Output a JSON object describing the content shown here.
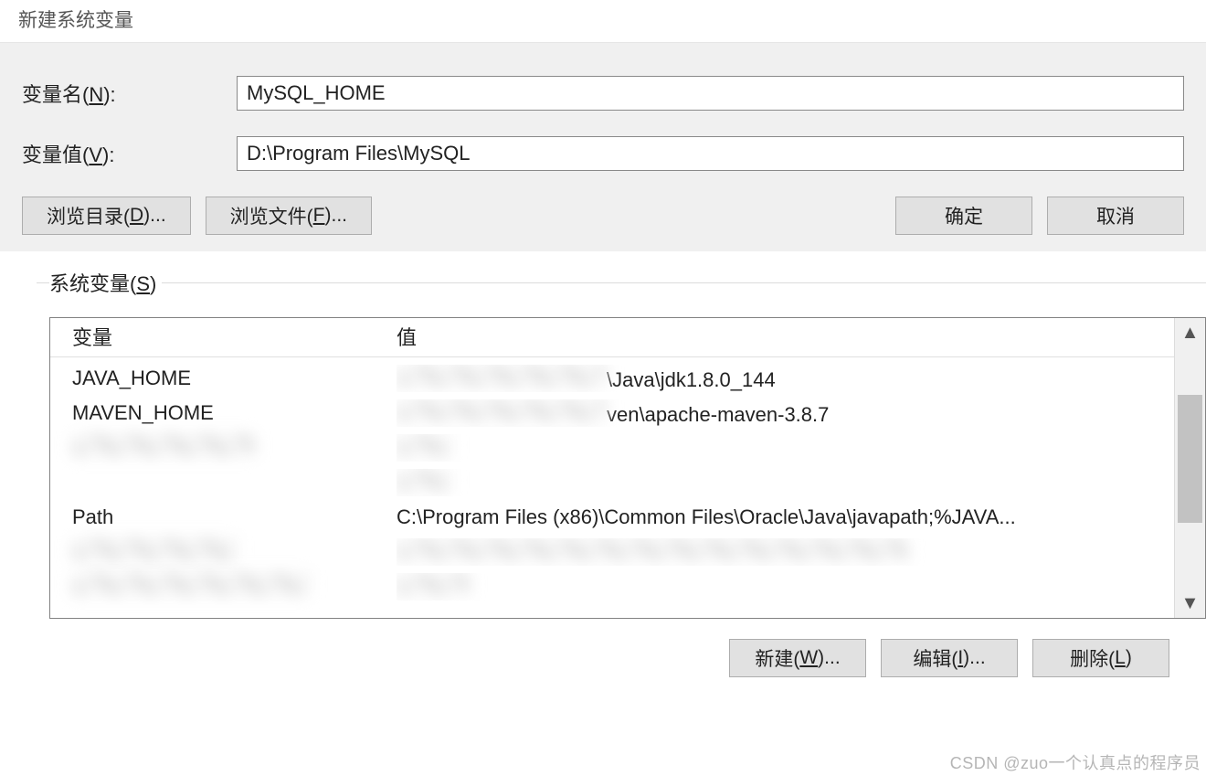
{
  "dialog": {
    "title": "新建系统变量",
    "name_label_pre": "变量名(",
    "name_label_key": "N",
    "name_label_post": "):",
    "value_label_pre": "变量值(",
    "value_label_key": "V",
    "value_label_post": "):",
    "name_value": "MySQL_HOME",
    "value_value": "D:\\Program Files\\MySQL",
    "browse_dir_pre": "浏览目录(",
    "browse_dir_key": "D",
    "browse_dir_post": ")...",
    "browse_file_pre": "浏览文件(",
    "browse_file_key": "F",
    "browse_file_post": ")...",
    "ok": "确定",
    "cancel": "取消"
  },
  "sysvars": {
    "legend_pre": "系统变量(",
    "legend_key": "S",
    "legend_post": ")",
    "header_variable": "变量",
    "header_value": "值",
    "rows": [
      {
        "var": "JAVA_HOME",
        "val_suffix": "\\Java\\jdk1.8.0_144"
      },
      {
        "var": "MAVEN_HOME",
        "val_suffix": "ven\\apache-maven-3.8.7"
      },
      {
        "var": "",
        "val_suffix": ""
      },
      {
        "var": "",
        "val_suffix": ""
      },
      {
        "var": "Path",
        "val_suffix": "C:\\Program Files (x86)\\Common Files\\Oracle\\Java\\javapath;%JAVA..."
      },
      {
        "var": "",
        "val_suffix": ""
      },
      {
        "var": "",
        "val_suffix": ""
      }
    ],
    "new_pre": "新建(",
    "new_key": "W",
    "new_post": ")...",
    "edit_pre": "编辑(",
    "edit_key": "I",
    "edit_post": ")...",
    "delete_pre": "删除(",
    "delete_key": "L",
    "delete_post": ")"
  },
  "watermark": "CSDN @zuo一个认真点的程序员"
}
